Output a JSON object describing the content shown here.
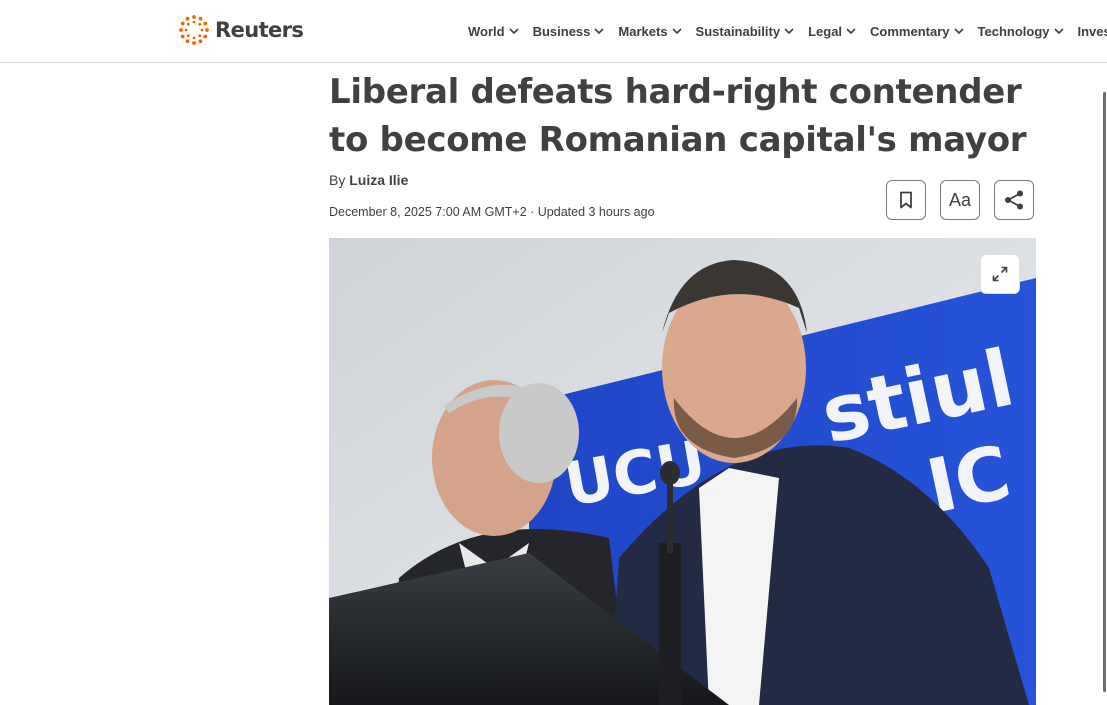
{
  "header": {
    "brand": "Reuters",
    "brand_color": "#fa6400",
    "nav": [
      "World",
      "Business",
      "Markets",
      "Sustainability",
      "Legal",
      "Commentary",
      "Technology",
      "Inves"
    ]
  },
  "article": {
    "headline": "Liberal defeats hard-right contender to become Romanian capital's mayor",
    "byline_prefix": "By",
    "author": "Luiza Ilie",
    "dateline": "December 8, 2025 7:00 AM GMT+2 · Updated 3 hours ago",
    "tools": {
      "bookmark_icon": "bookmark-icon",
      "font_size_label": "Aa",
      "share_icon": "share-icon"
    },
    "photo": {
      "expand_icon": "expand-icon",
      "banner_text": "stiul",
      "banner_text_lower": "UCU",
      "banner_text_right": "IC"
    }
  }
}
